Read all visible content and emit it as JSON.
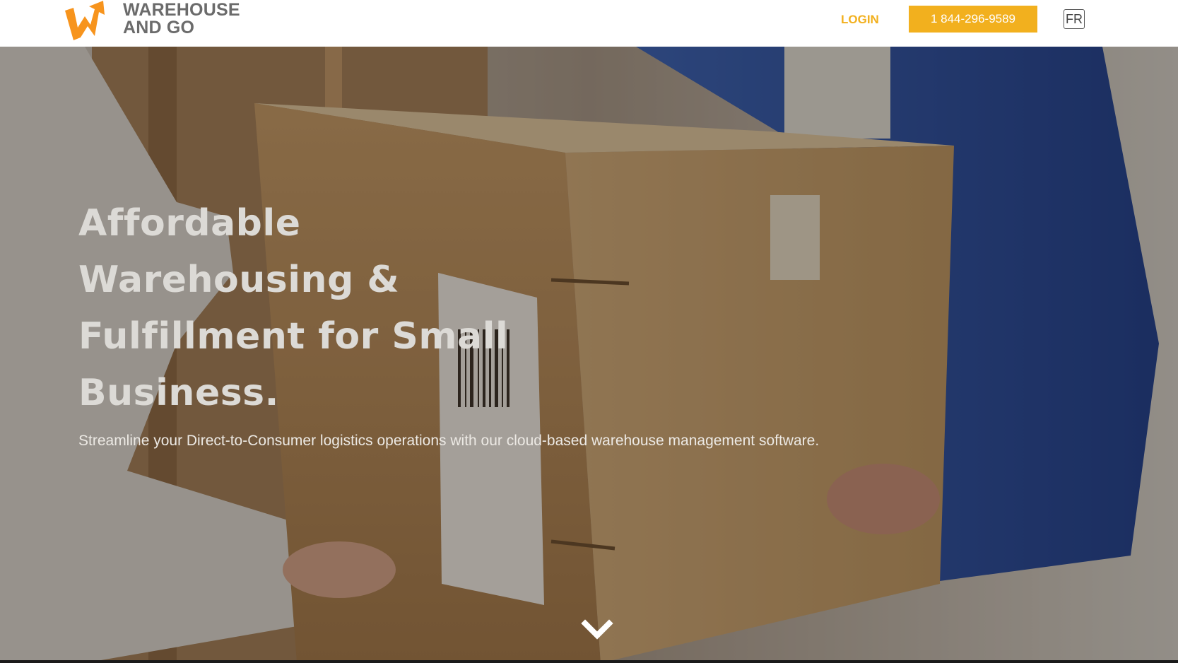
{
  "brand": {
    "name_line1": "WAREHOUSE",
    "name_line2": "AND GO",
    "accent_color": "#f2b01e",
    "logo_color": "#f7941d"
  },
  "header": {
    "login_label": "LOGIN",
    "phone_label": "1 844-296-9589",
    "language_label": "FR"
  },
  "hero": {
    "title_lines": [
      "Affordable",
      "Warehousing &",
      "Fulfillment for Small",
      "Business."
    ],
    "subtitle": "Streamline your Direct-to-Consumer logistics operations with our cloud-based warehouse management software.",
    "scroll_icon": "chevron-down-icon",
    "background_image": "delivery-box-handoff-photo"
  }
}
